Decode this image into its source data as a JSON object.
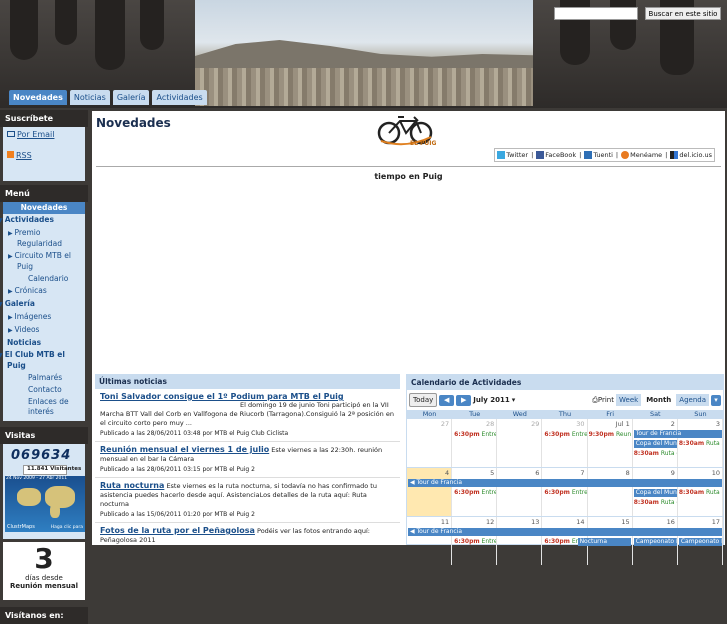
{
  "search": {
    "button": "Buscar en este sitio",
    "placeholder": ""
  },
  "tabs": [
    "Novedades",
    "Noticias",
    "Galería",
    "Actividades"
  ],
  "sidebar": {
    "suscribete": {
      "title": "Suscríbete",
      "email": "Por Email",
      "rss": "RSS"
    },
    "menu": {
      "title": "Menú",
      "items": [
        {
          "label": "Novedades",
          "level": 0,
          "selected": true
        },
        {
          "label": "Actividades",
          "level": 0,
          "arrow": "▼"
        },
        {
          "label": "Premio Regularidad",
          "level": 1,
          "arrow": "▶"
        },
        {
          "label": "Circuito MTB el Puig",
          "level": 1,
          "arrow": "▶"
        },
        {
          "label": "Calendario",
          "level": 2
        },
        {
          "label": "Crónicas",
          "level": 1,
          "arrow": "▶"
        },
        {
          "label": "Galería",
          "level": 0,
          "arrow": "▼"
        },
        {
          "label": "Imágenes",
          "level": 1,
          "arrow": "▶"
        },
        {
          "label": "Videos",
          "level": 1,
          "arrow": "▶"
        },
        {
          "label": "Noticias",
          "level": 0
        },
        {
          "label": "El Club MTB el Puig",
          "level": 0,
          "arrow": "▼"
        },
        {
          "label": "Palmarés",
          "level": 2
        },
        {
          "label": "Contacto",
          "level": 2
        },
        {
          "label": "Enlaces de interés",
          "level": 2
        }
      ]
    },
    "visitas": {
      "title": "Visitas",
      "counter": "069634",
      "visitors": "11.841 Visitantes",
      "dates": "24 Nov 2009 - 27 Abr 2011",
      "brand": "ClustrMaps",
      "hint": "Haga clic para"
    },
    "days": {
      "number": "3",
      "label": "días desde",
      "event": "Reunión mensual"
    },
    "visitanos": {
      "title": "Visítanos en:"
    }
  },
  "main": {
    "title": "Novedades",
    "logo_text": "EL PUIG",
    "share": [
      "Twitter",
      "FaceBook",
      "Tuenti",
      "Menéame",
      "del.icio.us"
    ],
    "tiempo": "tiempo en Puig",
    "ultimas": {
      "title": "Últimas noticias",
      "posts": [
        {
          "title": "Toni Salvador consigue el 1º Podium para MTB el Puig",
          "text": "El domingo 19 de junio Toni participó en la VII Marcha BTT Vall del Corb en Vallfogona de Riucorb (Tarragona).Consiguió la 2ª posición en el circuito corto pero muy ...",
          "meta": "Publicado a las 28/06/2011 03:48 por MTB el Puig Club Ciclista"
        },
        {
          "title": "Reunión mensual el viernes 1 de julio",
          "text": "Este viernes a las 22:30h. reunión mensual en el bar la Cámara",
          "meta": "Publicado a las 28/06/2011 03:15 por MTB el Puig 2"
        },
        {
          "title": "Ruta nocturna",
          "text": "Este viernes es la ruta nocturna, si todavía no has confirmado tu asistencia puedes hacerlo desde aquí. AsistenciaLos detalles de la ruta aquí: Ruta nocturna",
          "meta": "Publicado a las 15/06/2011 01:20 por MTB el Puig 2"
        },
        {
          "title": "Fotos de la ruta por el Peñagolosa",
          "text": "Podéis ver las fotos entrando aquí: Peñagolosa 2011",
          "meta": ""
        }
      ]
    },
    "calendar": {
      "title": "Calendario de Actividades",
      "today": "Today",
      "month": "July 2011",
      "print": "Print",
      "views": [
        "Week",
        "Month",
        "Agenda"
      ],
      "dow": [
        "Mon",
        "Tue",
        "Wed",
        "Thu",
        "Fri",
        "Sat",
        "Sun"
      ],
      "weeks": [
        [
          "27",
          "28",
          "29",
          "30",
          "Jul 1",
          "2",
          "3"
        ],
        [
          "4",
          "5",
          "6",
          "7",
          "8",
          "9",
          "10"
        ],
        [
          "11",
          "12",
          "13",
          "14",
          "15",
          "16",
          "17"
        ]
      ],
      "events": {
        "entrena": "Entrena",
        "time630": "6:30pm",
        "time930": "9:30pm",
        "time830": "8:30am",
        "reunion": "Reunión",
        "tour": "Tour de Francia",
        "copa": "Copa del Mundo",
        "ruta": "Ruta d",
        "ruta_s": "Ruta s",
        "nocturna": "Nocturna",
        "campeonato": "Campeonato E"
      }
    }
  }
}
